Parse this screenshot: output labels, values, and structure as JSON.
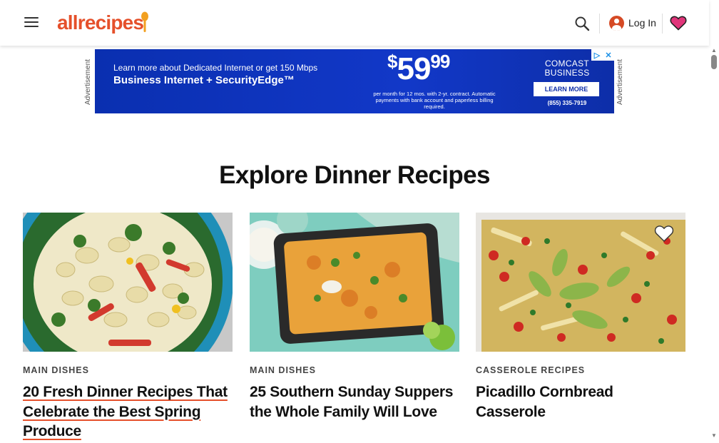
{
  "header": {
    "logo_text": "allrecipes",
    "login_label": "Log In",
    "icons": {
      "menu": "hamburger-menu-icon",
      "search": "search-icon",
      "user": "user-avatar-icon",
      "saved": "heart-icon"
    }
  },
  "ad": {
    "side_label": "Advertisement",
    "line1": "Learn more about Dedicated Internet or get 150 Mbps",
    "line2": "Business Internet + SecurityEdge™",
    "price_dollar": "$",
    "price_main": "59",
    "price_cents": "99",
    "fine_print": "per month for 12 mos. with 2-yr. contract. Automatic payments with bank account and paperless billing required.",
    "brand": "COMCAST BUSINESS",
    "cta": "LEARN MORE",
    "phone": "(855) 335-7919",
    "close_icons": [
      "adchoices-icon",
      "close-icon"
    ]
  },
  "section": {
    "title": "Explore Dinner Recipes"
  },
  "cards": [
    {
      "category": "MAIN DISHES",
      "title": "20 Fresh Dinner Recipes That Celebrate the Best Spring Produce",
      "image": "tortellini pasta salad with spinach, broccoli and red peppers in blue bowl"
    },
    {
      "category": "MAIN DISHES",
      "title": "25 Southern Sunday Suppers the Whole Family Will Love",
      "image": "baked cheesy casserole in black dish with jalapeño slices"
    },
    {
      "category": "CASSEROLE RECIPES",
      "title": "Picadillo Cornbread Casserole",
      "image": "cornbread casserole topped with avocado, tomatoes and cilantro"
    }
  ],
  "colors": {
    "brand": "#e5502b",
    "ad_blue": "#1238c8",
    "heart_pink": "#e0357a"
  }
}
